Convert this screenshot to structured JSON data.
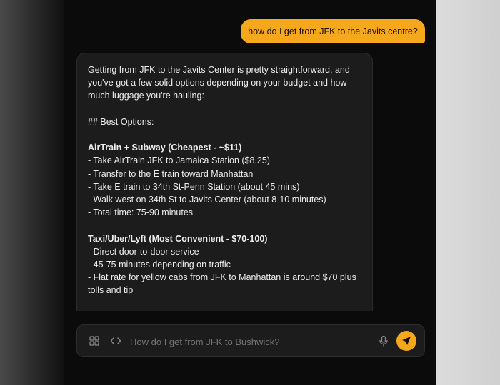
{
  "user_message": "how do I get from JFK to the Javits centre?",
  "assistant_message": {
    "intro": [
      "Getting from JFK to the Javits Center is pretty straightforward, and",
      "you've got a few solid options depending on your budget and how",
      "much luggage you're hauling:"
    ],
    "heading": "## Best Options:",
    "sections": [
      {
        "title": "AirTrain + Subway (Cheapest - ~$11)",
        "items": [
          "- Take AirTrain JFK to Jamaica Station ($8.25)",
          "- Transfer to the E train toward Manhattan",
          "- Take E train to 34th St-Penn Station (about 45 mins)",
          "- Walk west on 34th St to Javits Center (about 8-10 minutes)",
          "- Total time: 75-90 minutes"
        ]
      },
      {
        "title": "Taxi/Uber/Lyft (Most Convenient - $70-100)",
        "items": [
          "- Direct door-to-door service",
          "- 45-75 minutes depending on traffic",
          "- Flat rate for yellow cabs from JFK to Manhattan is around $70 plus",
          "tolls and tip"
        ]
      }
    ]
  },
  "composer": {
    "placeholder": "How do I get from JFK to Bushwick?",
    "icons": [
      "grid-icon",
      "code-icon",
      "microphone-icon",
      "send-icon"
    ]
  },
  "colors": {
    "accent": "#f5a81c",
    "bubble": "#1c1c1c",
    "background": "#0b0b0b"
  }
}
